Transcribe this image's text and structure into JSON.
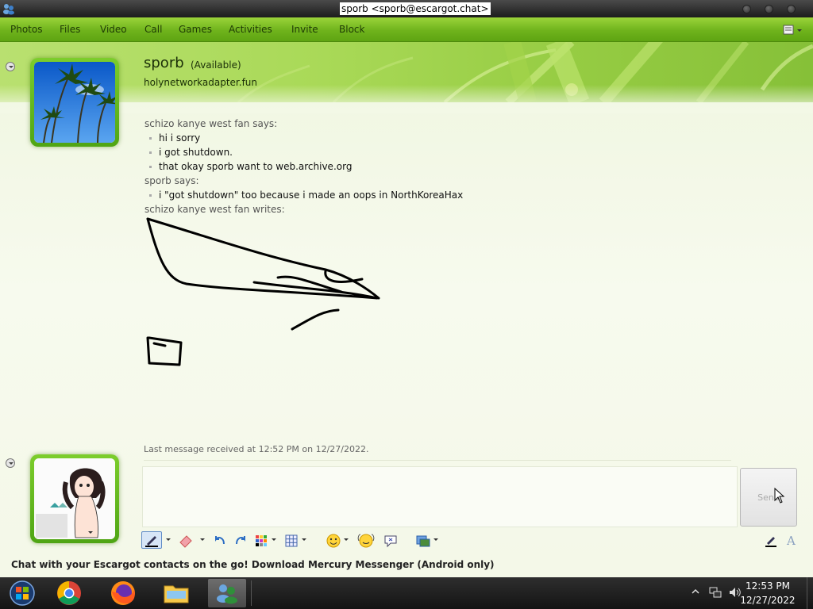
{
  "window": {
    "title": "sporb <sporb@escargot.chat>"
  },
  "menu": {
    "items": [
      "Photos",
      "Files",
      "Video",
      "Call",
      "Games",
      "Activities",
      "Invite",
      "Block"
    ]
  },
  "contact": {
    "name": "sporb",
    "status": "(Available)",
    "personal_message": "holynetworkadapter.fun"
  },
  "conversation": {
    "blocks": [
      {
        "sender": "schizo kanye west fan says:",
        "messages": [
          "hi i sorry",
          "i got shutdown.",
          "that okay sporb want to web.archive.org"
        ]
      },
      {
        "sender": "sporb says:",
        "messages": [
          "i \"got shutdown\" too because i made an oops in NorthKoreaHax"
        ]
      },
      {
        "sender": "schizo kanye west fan writes:",
        "messages": []
      }
    ]
  },
  "status_line": "Last message received at 12:52 PM on 12/27/2022.",
  "input": {
    "value": "",
    "send_label": "Send"
  },
  "promo": "Chat with your Escargot contacts on the go! Download Mercury Messenger (Android only)",
  "taskbar": {
    "apps": [
      "start-orb-icon",
      "chrome-icon",
      "firefox-icon",
      "file-explorer-icon",
      "messenger-icon"
    ],
    "time": "12:53 PM",
    "date": "12/27/2022"
  },
  "colors": {
    "accent": "#6fb31c",
    "header": "#a9d957",
    "taskbar": "#1d1d1d"
  }
}
